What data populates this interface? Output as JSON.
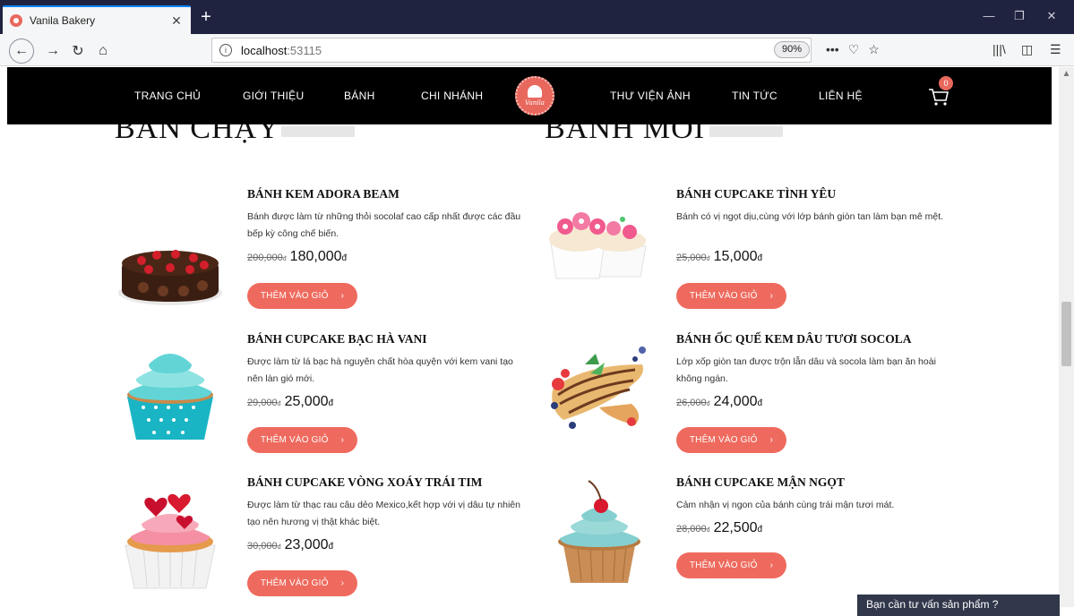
{
  "browser": {
    "tab_title": "Vanila Bakery",
    "tab_close": "✕",
    "new_tab": "+",
    "url_host": "localhost",
    "url_port": ":53115",
    "zoom": "90%",
    "win_minimize": "—",
    "win_restore": "❐",
    "win_close": "✕",
    "back": "←",
    "forward": "→",
    "reload": "↻",
    "home": "⌂",
    "more": "•••",
    "pocket": "♡",
    "bookmark": "☆",
    "library": "|||\\",
    "sidebar": "◫",
    "menu": "☰",
    "info": "i"
  },
  "site": {
    "menu": [
      "TRANG CHỦ",
      "GIỚI THIỆU",
      "BÁNH",
      "CHI NHÁNH",
      "THƯ VIỆN ẢNH",
      "TIN TỨC",
      "LIÊN HỆ"
    ],
    "logo_text": "Vanila",
    "cart_count": "0"
  },
  "sections": {
    "left_title": "BÁN CHẠY",
    "right_title": "BÁNH MỚI"
  },
  "products_left": [
    {
      "name": "BÁNH KEM ADORA BEAM",
      "desc": "Bánh được làm từ những thỏi socolaf cao cấp nhất được các đầu bếp kỳ công chế biến.",
      "old_price": "200,000",
      "old_cur": "đ",
      "new_price": "180,000",
      "new_cur": "đ",
      "button": "THÊM VÀO GIỎ",
      "arrow": "›"
    },
    {
      "name": "BÁNH CUPCAKE BẠC HÀ VANI",
      "desc": "Được làm từ lá bạc hà nguyên chất hòa quyện với kem vani tạo nên làn gió mới.",
      "old_price": "29,000",
      "old_cur": "đ",
      "new_price": "25,000",
      "new_cur": "đ",
      "button": "THÊM VÀO GIỎ",
      "arrow": "›"
    },
    {
      "name": "BÁNH CUPCAKE VÒNG XOÁY TRÁI TIM",
      "desc": "Được làm từ thạc rau câu dẻo Mexico,kết hợp với vị dâu tự nhiên tạo nên hương vị thật khác biệt.",
      "old_price": "30,000",
      "old_cur": "đ",
      "new_price": "23,000",
      "new_cur": "đ",
      "button": "THÊM VÀO GIỎ",
      "arrow": "›"
    }
  ],
  "products_right": [
    {
      "name": "BÁNH CUPCAKE TÌNH YÊU",
      "desc": "Bánh có vị ngọt dịu,cùng với lớp bánh giòn tan làm bạn mê mệt.",
      "old_price": "25,000",
      "old_cur": "đ",
      "new_price": "15,000",
      "new_cur": "đ",
      "button": "THÊM VÀO GIỎ",
      "arrow": "›"
    },
    {
      "name": "BÁNH ỐC QUẾ KEM DÂU TƯƠI SOCOLA",
      "desc": "Lớp xốp giòn tan được trộn lẫn dâu và socola làm bạn ăn hoài không ngán.",
      "old_price": "26,000",
      "old_cur": "đ",
      "new_price": "24,000",
      "new_cur": "đ",
      "button": "THÊM VÀO GIỎ",
      "arrow": "›"
    },
    {
      "name": "BÁNH CUPCAKE MẬN NGỌT",
      "desc": "Cảm nhận vị ngon của bánh cùng trái mận tươi mát.",
      "old_price": "28,000",
      "old_cur": "đ",
      "new_price": "22,500",
      "new_cur": "đ",
      "button": "THÊM VÀO GIỎ",
      "arrow": "›"
    }
  ],
  "chat": {
    "label": "Bạn cần tư vấn sản phẩm ?"
  },
  "colors": {
    "accent": "#ef6a5e",
    "header": "#000000",
    "tabbar": "#202340"
  }
}
